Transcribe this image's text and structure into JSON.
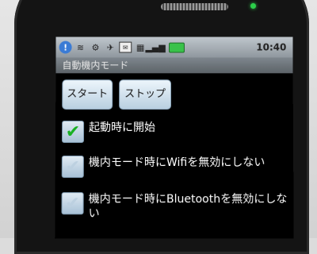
{
  "status_bar": {
    "clock": "10:40",
    "icons": [
      "info-icon",
      "wifi-icon",
      "usb-icon",
      "airplane-icon",
      "mail-icon",
      "sim-icon",
      "signal-icon",
      "battery-icon"
    ]
  },
  "app": {
    "title": "自動機内モード"
  },
  "buttons": {
    "start": "スタート",
    "stop": "ストップ"
  },
  "options": [
    {
      "label": "起動時に開始",
      "checked": true
    },
    {
      "label": "機内モード時にWifiを無効にしない",
      "checked": false
    },
    {
      "label": "機内モード時にBluetoothを無効にしない",
      "checked": false
    }
  ],
  "colors": {
    "check": "#18b022",
    "button_top": "#ecf5fb",
    "button_bottom": "#b9cfe0"
  }
}
